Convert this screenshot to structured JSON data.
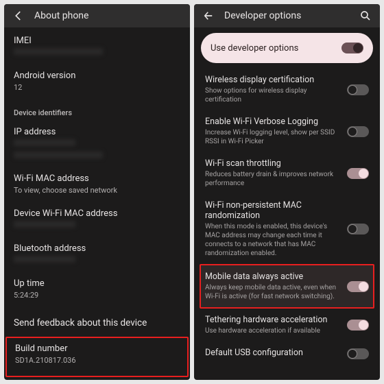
{
  "left": {
    "title": "About phone",
    "imei_label": "IMEI",
    "android_label": "Android version",
    "android_value": "12",
    "section_header": "Device identifiers",
    "ip_label": "IP address",
    "wifi_mac_label": "Wi-Fi MAC address",
    "wifi_mac_value": "To view, choose saved network",
    "device_wifi_mac_label": "Device Wi-Fi MAC address",
    "bt_label": "Bluetooth address",
    "uptime_label": "Up time",
    "uptime_value": "5:24:29",
    "feedback_label": "Send feedback about this device",
    "build_label": "Build number",
    "build_value": "SD1A.210817.036"
  },
  "right": {
    "title": "Developer options",
    "use_dev_label": "Use developer options",
    "items": [
      {
        "label": "Wireless display certification",
        "desc": "Show options for wireless display certification",
        "on": false
      },
      {
        "label": "Enable Wi-Fi Verbose Logging",
        "desc": "Increase Wi-Fi logging level, show per SSID RSSI in Wi-Fi Picker",
        "on": false
      },
      {
        "label": "Wi-Fi scan throttling",
        "desc": "Reduces battery drain & improves network performance",
        "on": true
      },
      {
        "label": "Wi-Fi non-persistent MAC randomization",
        "desc": "When this mode is enabled, this device's MAC address may change each time it connects to a network that has MAC randomization enabled.",
        "on": false
      },
      {
        "label": "Mobile data always active",
        "desc": "Always keep mobile data active, even when Wi-Fi is active (for fast network switching).",
        "on": true,
        "highlight": true
      },
      {
        "label": "Tethering hardware acceleration",
        "desc": "Use hardware acceleration if available",
        "on": true
      },
      {
        "label": "Default USB configuration",
        "desc": "",
        "on": false
      }
    ]
  }
}
